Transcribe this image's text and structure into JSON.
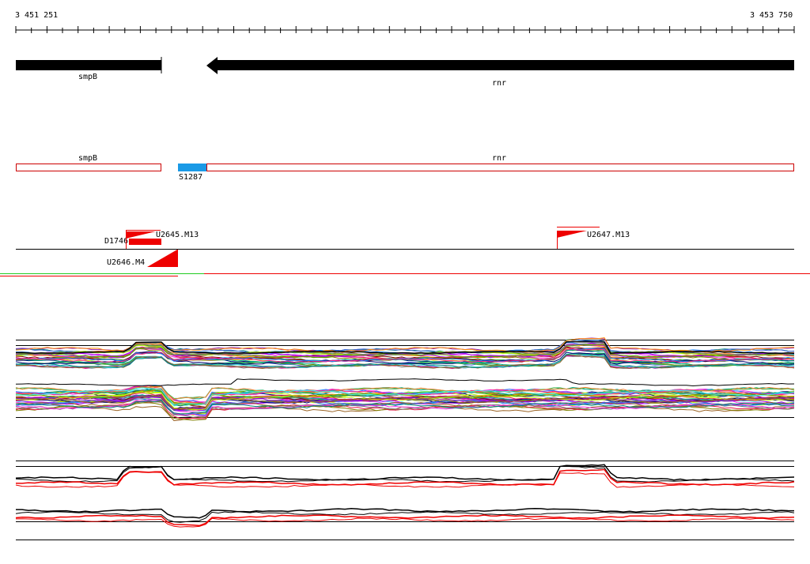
{
  "coords": {
    "start": "3 451 251",
    "end": "3 453 750"
  },
  "genes": [
    {
      "name": "smpB",
      "strand": "+"
    },
    {
      "name": "rnr",
      "strand": "-"
    }
  ],
  "annotations": {
    "smpB": "smpB",
    "rnr": "rnr",
    "feature": "S1287",
    "feature_color": "#1a9ae6"
  },
  "tiles": [
    {
      "label": "D1746"
    },
    {
      "label": "U2645.M13"
    },
    {
      "label": "U2646.M4"
    },
    {
      "label": "U2647.M13"
    }
  ],
  "colors": {
    "gene": "#000000",
    "annotation_border": "#cc0000",
    "tile": "#ee0000",
    "track_green": "#22cc22",
    "track_red": "#ee0000"
  }
}
